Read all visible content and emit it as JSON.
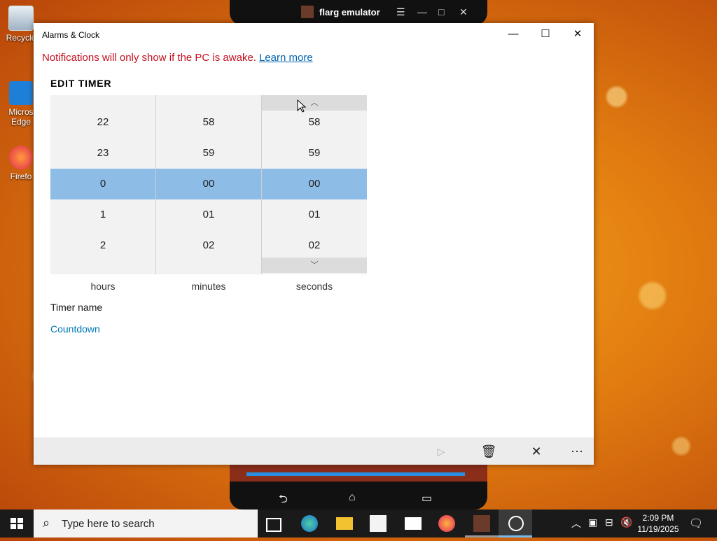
{
  "desktop": {
    "icons": [
      {
        "label": "Recycle"
      },
      {
        "label": "Micros Edge"
      },
      {
        "label": "Firefo"
      }
    ]
  },
  "emulator": {
    "title": "flarg emulator"
  },
  "window": {
    "title": "Alarms & Clock",
    "notice_text": "Notifications will only show if the PC is awake.",
    "notice_link": "Learn more",
    "heading": "EDIT TIMER",
    "hours_values": [
      "22",
      "23",
      "0",
      "1",
      "2"
    ],
    "minutes_values": [
      "58",
      "59",
      "00",
      "01",
      "02"
    ],
    "seconds_values": [
      "58",
      "59",
      "00",
      "01",
      "02"
    ],
    "labels": {
      "hours": "hours",
      "minutes": "minutes",
      "seconds": "seconds"
    },
    "timer_name_label": "Timer name",
    "timer_name_value": "Countdown",
    "selection_color": "#8dbce6",
    "notice_color": "#c50f1f",
    "link_color": "#0063b1"
  },
  "taskbar": {
    "search_placeholder": "Type here to search",
    "time": "2:09 PM",
    "date": "11/19/2025"
  }
}
